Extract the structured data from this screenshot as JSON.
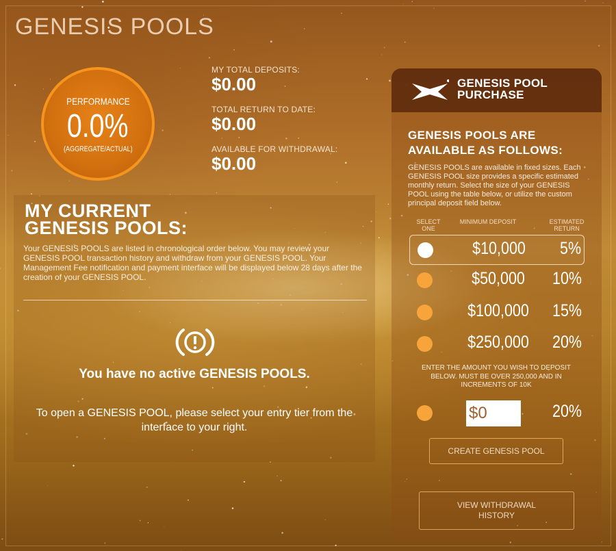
{
  "page": {
    "title": "GENESIS POOLS"
  },
  "performance": {
    "label": "PERFORMANCE",
    "value": "0.0%",
    "sublabel": "(AGGREGATE/ACTUAL)"
  },
  "stats": [
    {
      "label": "MY TOTAL DEPOSITS:",
      "value": "$0.00"
    },
    {
      "label": "TOTAL RETURN TO DATE:",
      "value": "$0.00"
    },
    {
      "label": "AVAILABLE FOR WITHDRAWAL:",
      "value": "$0.00"
    }
  ],
  "current_pools": {
    "title_line1": "MY CURRENT",
    "title_line2": "GENESIS POOLS:",
    "description": "Your GENESIS POOLS are listed in chronological order below. You may review your GENESIS POOL transaction history and withdraw from your GENESIS POOL. Your Management Fee notification and payment interface will be displayed below 28 days after the creation of your GENESIS POOL.",
    "empty_message": "You have no active GENESIS POOLS.",
    "empty_hint": "To open a GENESIS POOL, please select your entry tier from the interface to your right."
  },
  "purchase": {
    "header_line1": "GENESIS POOL",
    "header_line2": "PURCHASE",
    "available_line1": "GENESIS POOLS ARE",
    "available_line2": "AVAILABLE AS FOLLOWS:",
    "description": "GENESIS POOLS are available in fixed sizes. Each GENESIS POOL size provides a specific estimated monthly return. Select the size of your GENESIS POOL using the table below, or utilize the custom principal deposit field below.",
    "columns": {
      "select_line1": "SELECT",
      "select_line2": "ONE",
      "minimum": "MINIMUM DEPOSIT",
      "return_line1": "ESTIMATED",
      "return_line2": "RETURN"
    },
    "tiers": [
      {
        "amount": "$10,000",
        "return": "5%",
        "selected": true
      },
      {
        "amount": "$50,000",
        "return": "10%",
        "selected": false
      },
      {
        "amount": "$100,000",
        "return": "15%",
        "selected": false
      },
      {
        "amount": "$250,000",
        "return": "20%",
        "selected": false
      }
    ],
    "custom_note": "ENTER THE AMOUNT YOU WISH TO DEPOSIT BELOW. MUST BE OVER 250,000 AND IN INCREMENTS OF 10K",
    "custom_value": "$0",
    "custom_return": "20%",
    "create_button": "CREATE GENESIS POOL",
    "history_button": "VIEW WITHDRAWAL HISTORY"
  },
  "colors": {
    "accent_orange": "#f7941d",
    "radio_orange": "#f7a53b",
    "header_brown": "#5a280c"
  }
}
